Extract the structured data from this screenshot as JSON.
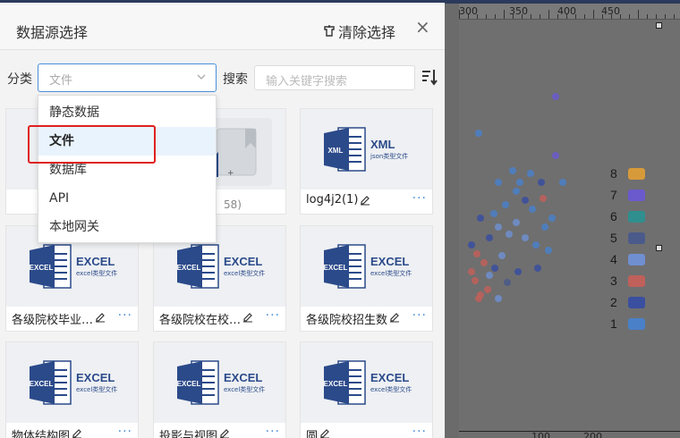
{
  "dialog": {
    "title": "数据源选择",
    "clear_label": "清除选择",
    "close_glyph": "×"
  },
  "filter": {
    "category_label": "分类",
    "category_value": "文件",
    "search_label": "搜索",
    "search_placeholder": "输入关键字搜索"
  },
  "dropdown": {
    "items": [
      {
        "label": "静态数据",
        "selected": false
      },
      {
        "label": "文件",
        "selected": true
      },
      {
        "label": "数据库",
        "selected": false
      },
      {
        "label": "API",
        "selected": false
      },
      {
        "label": "本地网关",
        "selected": false
      }
    ]
  },
  "cards": [
    {
      "name": "",
      "type": "static",
      "ext": ""
    },
    {
      "name": "",
      "type": "folder",
      "ext": "",
      "partial_text": "58)"
    },
    {
      "name": "log4j2(1)",
      "type": "xml",
      "ext": "XML",
      "sub": "json类型文件"
    },
    {
      "name": "各级院校毕业…",
      "type": "excel",
      "ext": "EXCEL",
      "sub": "excel类型文件"
    },
    {
      "name": "各级院校在校…",
      "type": "excel",
      "ext": "EXCEL",
      "sub": "excel类型文件"
    },
    {
      "name": "各级院校招生数",
      "type": "excel",
      "ext": "EXCEL",
      "sub": "excel类型文件"
    },
    {
      "name": "物体结构图",
      "type": "excel",
      "ext": "EXCEL",
      "sub": "excel类型文件"
    },
    {
      "name": "投影与视图",
      "type": "excel",
      "ext": "EXCEL",
      "sub": "excel类型文件"
    },
    {
      "name": "圆",
      "type": "excel",
      "ext": "EXCEL",
      "sub": "excel类型文件"
    }
  ],
  "more_glyph": "···",
  "ruler": {
    "labels": [
      "300",
      "350",
      "400",
      "450"
    ]
  },
  "bottom_axis": {
    "labels": [
      "100",
      "200"
    ]
  },
  "legend": [
    {
      "label": "8",
      "color": "#d69a3a"
    },
    {
      "label": "7",
      "color": "#6a5acd"
    },
    {
      "label": "6",
      "color": "#2f8f8f"
    },
    {
      "label": "5",
      "color": "#4a5a8a"
    },
    {
      "label": "4",
      "color": "#6f8fd0"
    },
    {
      "label": "3",
      "color": "#c0605a"
    },
    {
      "label": "2",
      "color": "#3a4fa0"
    },
    {
      "label": "1",
      "color": "#4a80c8"
    }
  ],
  "colors": {
    "accent": "#4a90d9",
    "highlight": "#e02020",
    "excel_blue": "#2b4a8a"
  }
}
